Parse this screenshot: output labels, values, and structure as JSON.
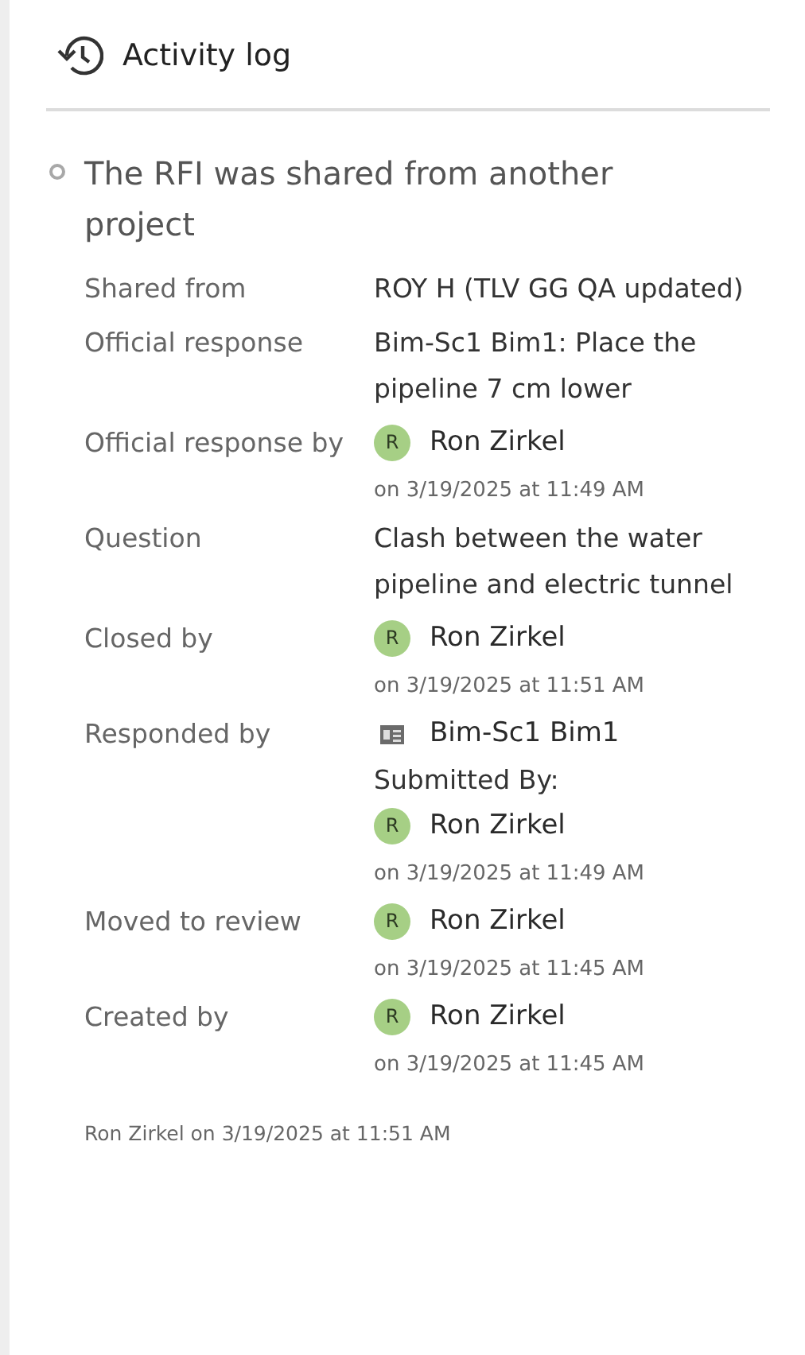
{
  "header": {
    "title": "Activity log"
  },
  "entry": {
    "title": "The RFI was shared from another project",
    "fields": [
      {
        "label": "Shared from",
        "parts": [
          {
            "kind": "text",
            "text": "ROY H (TLV GG QA updated)"
          }
        ]
      },
      {
        "label": "Official response",
        "parts": [
          {
            "kind": "text",
            "text": "Bim-Sc1 Bim1: Place the pipeline 7 cm lower"
          }
        ]
      },
      {
        "label": "Official response by",
        "parts": [
          {
            "kind": "user",
            "initial": "R",
            "name": "Ron Zirkel",
            "time": "on 3/19/2025 at 11:49 AM"
          }
        ]
      },
      {
        "label": "Question",
        "parts": [
          {
            "kind": "text",
            "text": "Clash between the water pipeline and electric tunnel"
          }
        ]
      },
      {
        "label": "Closed by",
        "parts": [
          {
            "kind": "user",
            "initial": "R",
            "name": "Ron Zirkel",
            "time": "on 3/19/2025 at 11:51 AM"
          }
        ]
      },
      {
        "label": "Responded by",
        "parts": [
          {
            "kind": "app",
            "name": "Bim-Sc1 Bim1"
          },
          {
            "kind": "text",
            "text": "Submitted By:"
          },
          {
            "kind": "user",
            "initial": "R",
            "name": "Ron Zirkel",
            "time": "on 3/19/2025 at 11:49 AM"
          }
        ]
      },
      {
        "label": "Moved to review",
        "parts": [
          {
            "kind": "user",
            "initial": "R",
            "name": "Ron Zirkel",
            "time": "on 3/19/2025 at 11:45 AM"
          }
        ]
      },
      {
        "label": "Created by",
        "parts": [
          {
            "kind": "user",
            "initial": "R",
            "name": "Ron Zirkel",
            "time": "on 3/19/2025 at 11:45 AM"
          }
        ]
      }
    ],
    "footer": "Ron Zirkel on 3/19/2025 at 11:51 AM"
  }
}
